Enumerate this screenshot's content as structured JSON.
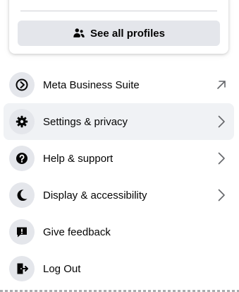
{
  "profile_panel": {
    "see_all_label": "See all profiles",
    "see_all_icon": "profiles-switch-icon"
  },
  "menu": {
    "items": [
      {
        "label": "Meta Business Suite",
        "icon": "meta-business-suite-icon",
        "trailing": "external-arrow-icon",
        "active": false
      },
      {
        "label": "Settings & privacy",
        "icon": "gear-icon",
        "trailing": "chevron-right-icon",
        "active": true
      },
      {
        "label": "Help & support",
        "icon": "question-icon",
        "trailing": "chevron-right-icon",
        "active": false
      },
      {
        "label": "Display & accessibility",
        "icon": "moon-icon",
        "trailing": "chevron-right-icon",
        "active": false
      },
      {
        "label": "Give feedback",
        "icon": "feedback-icon",
        "trailing": "",
        "active": false
      },
      {
        "label": "Log Out",
        "icon": "logout-icon",
        "trailing": "",
        "active": false
      }
    ]
  },
  "colors": {
    "button_bg": "#e4e6eb",
    "hover_bg": "#f0f2f5",
    "text_primary": "#050505",
    "icon_gray": "#65676b"
  }
}
